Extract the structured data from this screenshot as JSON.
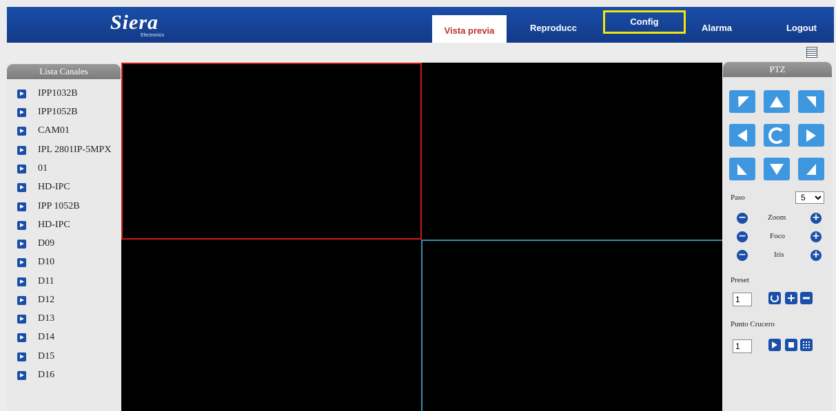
{
  "brand": {
    "name": "Siera",
    "subtitle": "Electronics"
  },
  "nav": [
    "Vista previa",
    "Reproducc",
    "Config",
    "Alarma",
    "Logout"
  ],
  "channels": {
    "title": "Lista Canales",
    "items": [
      "IPP1032B",
      "IPP1052B",
      "CAM01",
      "IPL 2801IP-5MPX",
      "01",
      "HD-IPC",
      "IPP 1052B",
      "HD-IPC",
      "D09",
      "D10",
      "D11",
      "D12",
      "D13",
      "D14",
      "D15",
      "D16"
    ]
  },
  "ptz": {
    "title": "PTZ",
    "paso_label": "Paso",
    "paso_value": "5",
    "zoom_label": "Zoom",
    "foco_label": "Foco",
    "iris_label": "Iris",
    "preset_label": "Preset",
    "preset_value": "1",
    "crucero_label": "Punto Crucero",
    "crucero_value": "1"
  },
  "colors": {
    "primary": "#1a4ea8",
    "active_video_border": "#d11a1a",
    "video_grid_line": "#3b8ea8",
    "ptz_button": "#3f97e0"
  }
}
